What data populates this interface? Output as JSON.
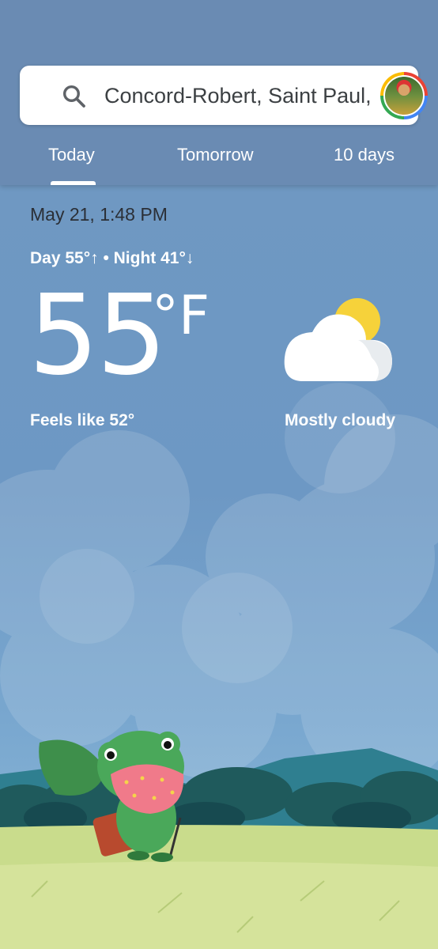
{
  "search": {
    "location": "Concord-Robert, Saint Paul, ..."
  },
  "tabs": [
    {
      "label": "Today",
      "selected": true
    },
    {
      "label": "Tomorrow",
      "selected": false
    },
    {
      "label": "10 days",
      "selected": false
    }
  ],
  "current": {
    "datetime": "May 21, 1:48 PM",
    "day_night": "Day 55°↑ • Night 41°↓",
    "temperature": "55",
    "unit": "°F",
    "feels_like": "Feels like 52°",
    "condition": "Mostly cloudy",
    "icon": "mostly-cloudy-icon"
  },
  "colors": {
    "header_bg": "#6a8bb3",
    "sky": "#6f98c2",
    "sun": "#f6d23a",
    "grass": "#c9dc8c",
    "mountain": "#2f7f90"
  }
}
